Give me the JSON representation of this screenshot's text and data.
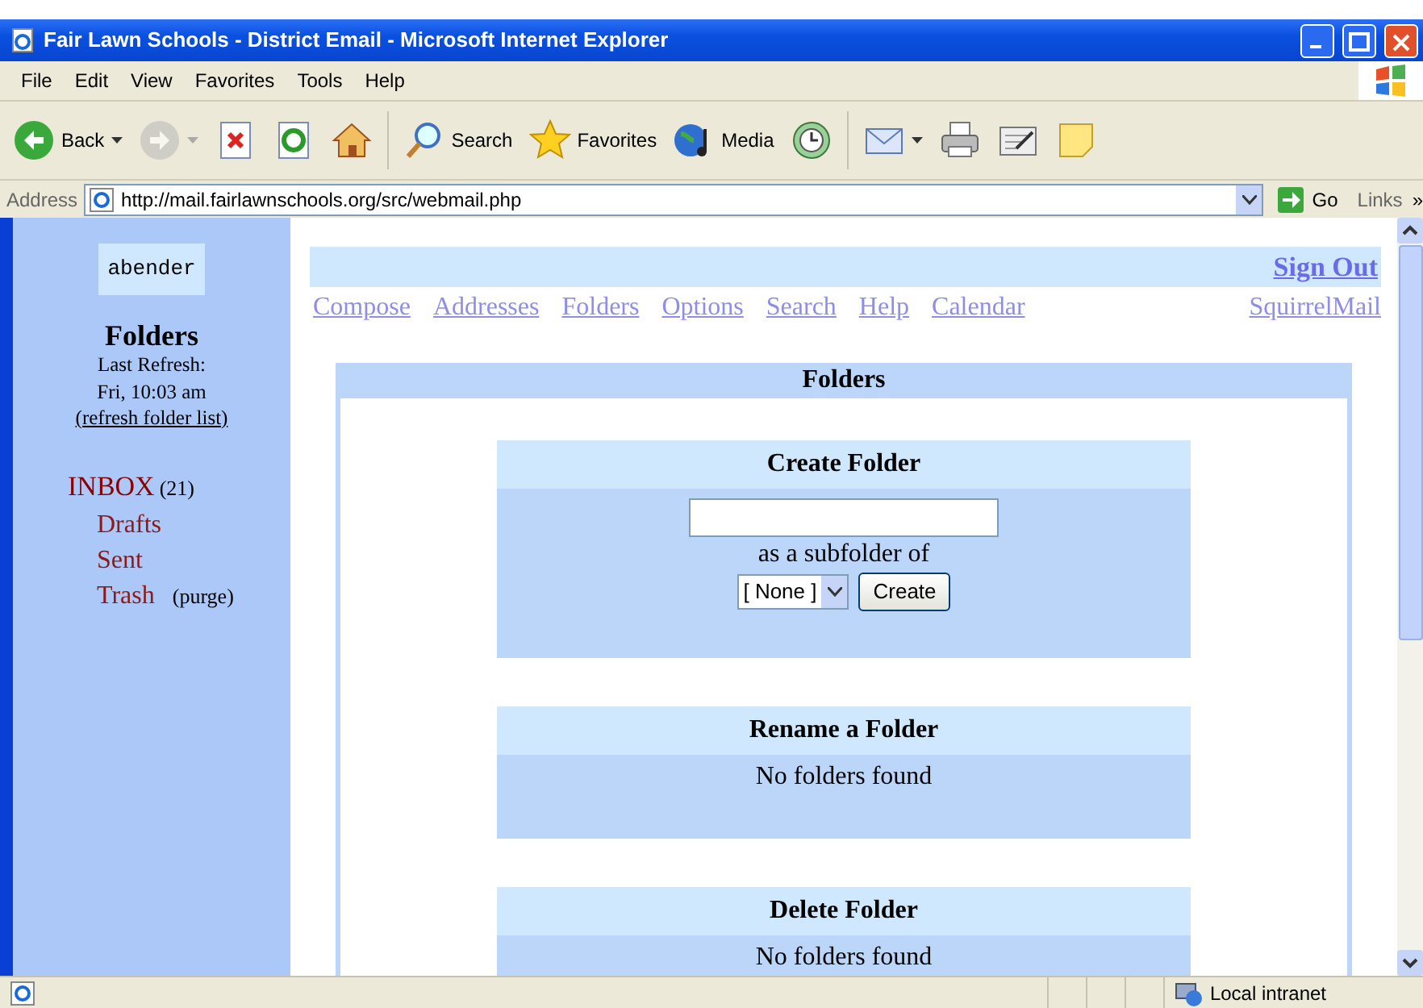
{
  "window": {
    "title": "Fair Lawn Schools - District Email - Microsoft Internet Explorer"
  },
  "menu": [
    "File",
    "Edit",
    "View",
    "Favorites",
    "Tools",
    "Help"
  ],
  "toolbar": [
    {
      "kind": "back",
      "label": "Back",
      "dropdown": true,
      "disabled": false
    },
    {
      "kind": "forward",
      "dropdown": true,
      "disabled": true
    },
    {
      "kind": "stop",
      "disabled": false
    },
    {
      "kind": "refresh",
      "disabled": false
    },
    {
      "kind": "home",
      "disabled": false
    },
    {
      "kind": "search",
      "label": "Search",
      "disabled": false
    },
    {
      "kind": "favorites",
      "label": "Favorites",
      "disabled": false
    },
    {
      "kind": "media",
      "label": "Media",
      "disabled": false
    },
    {
      "kind": "history",
      "disabled": false
    },
    {
      "kind": "mail",
      "dropdown": true,
      "disabled": false
    },
    {
      "kind": "print",
      "disabled": false
    },
    {
      "kind": "edit",
      "disabled": false
    },
    {
      "kind": "note",
      "disabled": false
    }
  ],
  "address": {
    "label": "Address",
    "value": "http://mail.fairlawnschools.org/src/webmail.php",
    "go": "Go",
    "links": "Links",
    "more": "»"
  },
  "sidebar": {
    "username": "abender",
    "heading": "Folders",
    "refresh_label": "Last Refresh:",
    "refresh_time": "Fri, 10:03 am",
    "refresh_link": "(refresh folder list)",
    "folders": [
      {
        "name": "INBOX",
        "count": "(21)",
        "children": [
          {
            "name": "Drafts"
          },
          {
            "name": "Sent"
          },
          {
            "name": "Trash",
            "action": "(purge)"
          }
        ]
      }
    ]
  },
  "top": {
    "sign_out": "Sign Out",
    "nav": [
      "Compose",
      "Addresses",
      "Folders",
      "Options",
      "Search",
      "Help",
      "Calendar"
    ],
    "brand": "SquirrelMail"
  },
  "panel": {
    "title": "Folders",
    "sections": [
      {
        "kind": "create",
        "title": "Create Folder",
        "subfolder_label": "as a subfolder of",
        "select": "[ None ]",
        "button": "Create"
      },
      {
        "kind": "message",
        "title": "Rename a Folder",
        "message": "No folders found"
      },
      {
        "kind": "message",
        "title": "Delete Folder",
        "message": "No folders found"
      }
    ]
  },
  "status_bar": {
    "zone": "Local intranet"
  }
}
